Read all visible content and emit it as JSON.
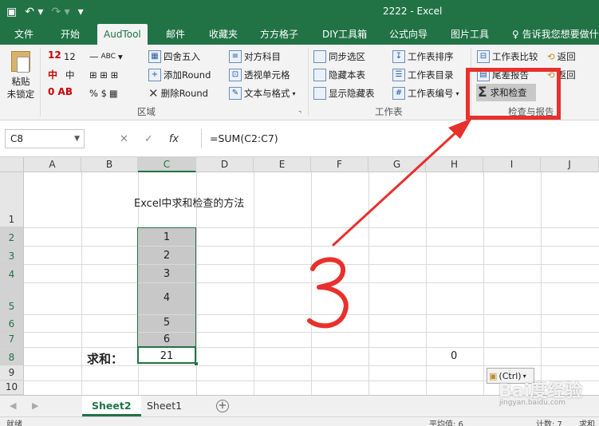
{
  "app": {
    "window_title": "2222  -  Excel"
  },
  "qat": {
    "save_icon": "save-icon",
    "undo_icon": "undo-icon",
    "redo_icon": "redo-icon",
    "customize_icon": "customize-icon"
  },
  "tabs": [
    {
      "label": "文件"
    },
    {
      "label": "开始"
    },
    {
      "label": "AudTool"
    },
    {
      "label": "邮件"
    },
    {
      "label": "收藏夹"
    },
    {
      "label": "方方格子"
    },
    {
      "label": "DIY工具箱"
    },
    {
      "label": "公式向导"
    },
    {
      "label": "图片工具"
    },
    {
      "label": "告诉我您想要做什"
    }
  ],
  "ribbon": {
    "paste_label": "粘贴",
    "unlock_label": "未锁定",
    "region_group": "区域",
    "worksheet_group": "工作表",
    "check_group": "检查与报告",
    "row1": {
      "num": "12",
      "round": "四舍五入",
      "subject": "对方科目",
      "sync": "同步选区",
      "sheet_sort": "工作表排序",
      "sheet_compare": "工作表比较",
      "back1": "返回"
    },
    "row2": {
      "mid": "中",
      "add_round": "添加Round",
      "pivot_cell": "透视单元格",
      "hide_sheet": "隐藏本表",
      "sheet_index": "工作表目录",
      "tail_report": "尾差报告",
      "back2": "返回"
    },
    "row3": {
      "symbols": "% $",
      "del_round": "删除Round",
      "text_format": "文本与格式",
      "show_hidden": "显示隐藏表",
      "sheet_number": "工作表编号"
    },
    "sum_check": "求和检查"
  },
  "formula_bar": {
    "name_box": "C8",
    "formula": "=SUM(C2:C7)"
  },
  "columns": [
    "A",
    "B",
    "C",
    "D",
    "E",
    "F",
    "G",
    "H",
    "I",
    "J"
  ],
  "rows": [
    "1",
    "2",
    "3",
    "4",
    "5",
    "6",
    "7",
    "8",
    "9",
    "10"
  ],
  "cells": {
    "title_text": "Excel中求和检查的方法",
    "c_values": [
      "1",
      "2",
      "3",
      "4",
      "5",
      "6"
    ],
    "sum_label": "求和：",
    "sum_value": "21",
    "h8_value": "0",
    "paste_opt_label": "(Ctrl)"
  },
  "annotation": {
    "handwritten": "3",
    "color": "#e8302d"
  },
  "sheets": {
    "active": "Sheet2",
    "other": "Sheet1"
  },
  "status": {
    "left": "就绪",
    "average": "平均值: 6",
    "count": "计数: 7",
    "sum": "求和"
  },
  "watermark": {
    "logo": "Bai度经验",
    "url": "jingyan.baidu.com"
  }
}
